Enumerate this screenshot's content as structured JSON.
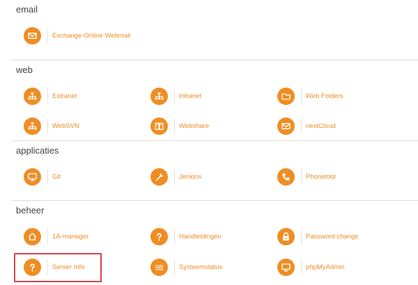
{
  "sections": {
    "email": {
      "title": "email",
      "items": [
        {
          "label": "Exchange-Online Webmail",
          "icon": "envelope-icon"
        }
      ]
    },
    "web": {
      "title": "web",
      "items": [
        {
          "label": "Extranet",
          "icon": "network-icon"
        },
        {
          "label": "Intranet",
          "icon": "network-icon"
        },
        {
          "label": "Web Folders",
          "icon": "folder-icon"
        },
        {
          "label": "WebSVN",
          "icon": "network-icon"
        },
        {
          "label": "Webshare",
          "icon": "book-icon"
        },
        {
          "label": "nextCloud",
          "icon": "envelope-icon"
        }
      ]
    },
    "applicaties": {
      "title": "applicaties",
      "items": [
        {
          "label": "Git",
          "icon": "monitor-icon"
        },
        {
          "label": "Jenkins",
          "icon": "wrench-icon"
        },
        {
          "label": "Phonetool",
          "icon": "phone-icon"
        }
      ]
    },
    "beheer": {
      "title": "beheer",
      "items": [
        {
          "label": "1A-manager",
          "icon": "home-icon"
        },
        {
          "label": "Handleidingen",
          "icon": "question-icon"
        },
        {
          "label": "Password change",
          "icon": "lock-icon"
        },
        {
          "label": "Server Info",
          "icon": "question-icon"
        },
        {
          "label": "Systeemstatus",
          "icon": "waves-icon"
        },
        {
          "label": "phpMyAdmin",
          "icon": "monitor-icon"
        }
      ]
    }
  },
  "colors": {
    "accent": "#ef8d23",
    "highlight": "#d9434a",
    "rule": "#dcdcdc"
  }
}
